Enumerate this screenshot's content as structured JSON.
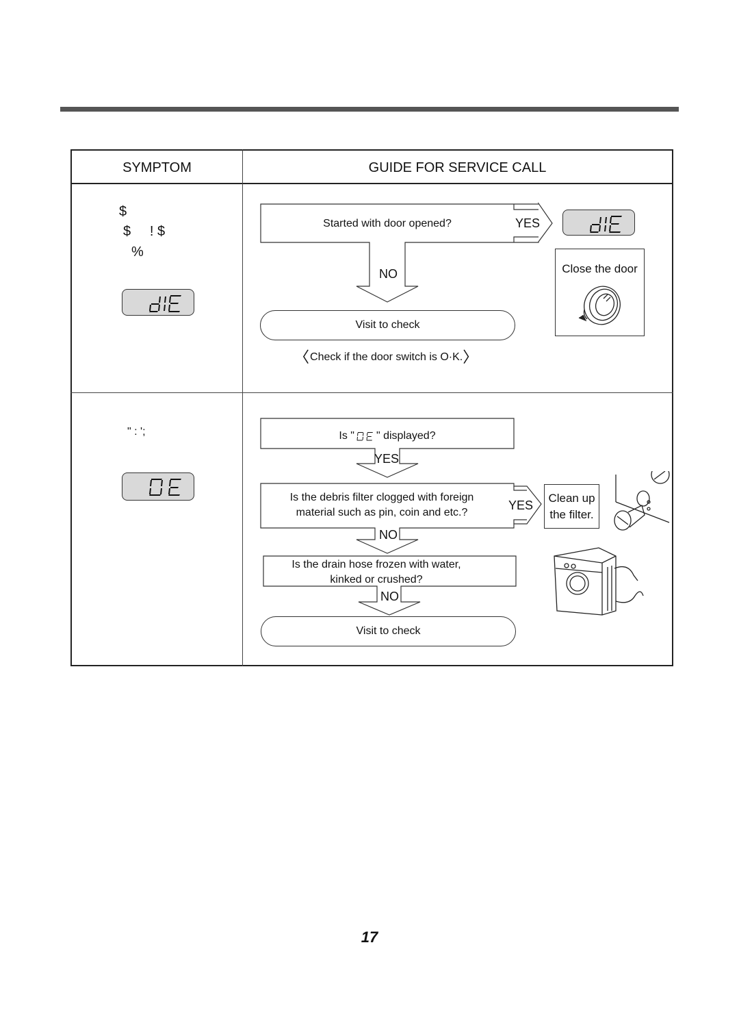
{
  "table": {
    "header": {
      "symptom": "SYMPTOM",
      "guide": "GUIDE FOR SERVICE CALL"
    },
    "rows": [
      {
        "symptom": {
          "lines": [
            "$",
            "$     ! $",
            "%"
          ],
          "display_code": "dE"
        },
        "flow": {
          "question": "Started with door opened?",
          "yes_label": "YES",
          "no_label": "NO",
          "yes_display_code": "dE",
          "yes_action": "Close the door",
          "no_action": "Visit to check",
          "note": "Check if the door switch is O·K."
        }
      },
      {
        "symptom": {
          "lines": [
            "\" : ';"
          ],
          "display_code": "OE"
        },
        "flow": {
          "q1_prefix": "Is \"",
          "q1_code": "OE",
          "q1_suffix": "\" displayed?",
          "q1_yes_label": "YES",
          "q2_line1": "Is the debris filter clogged with foreign",
          "q2_line2": "material such as pin, coin and etc.?",
          "q2_yes_label": "YES",
          "q2_yes_action_line1": "Clean up",
          "q2_yes_action_line2": "the filter.",
          "q2_no_label": "NO",
          "q3_line1": "Is the drain hose frozen with water,",
          "q3_line2": "kinked or crushed?",
          "q3_no_label": "NO",
          "final_action": "Visit to check"
        }
      }
    ]
  },
  "page_number": "17"
}
